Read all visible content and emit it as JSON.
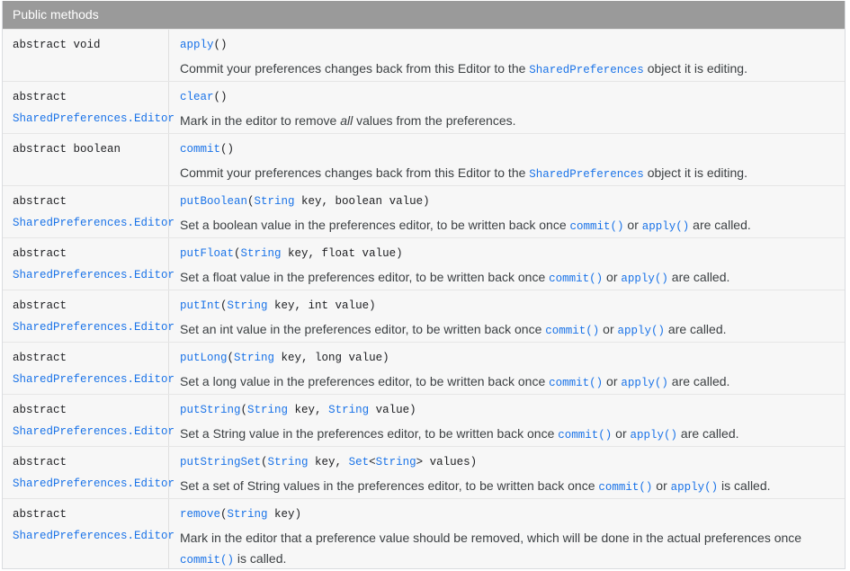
{
  "header": {
    "title": "Public methods"
  },
  "rows": [
    {
      "mod": "abstract void",
      "ret": "",
      "name": "apply",
      "params": "()",
      "d1": "Commit your preferences changes back from this Editor to the ",
      "dc1": "SharedPreferences",
      "d2": " object it is editing."
    },
    {
      "mod": "abstract",
      "ret": "SharedPreferences.Editor",
      "name": "clear",
      "params": "()",
      "d1": "Mark in the editor to remove ",
      "em": "all",
      "d2": " values from the preferences."
    },
    {
      "mod": "abstract boolean",
      "ret": "",
      "name": "commit",
      "params": "()",
      "d1": "Commit your preferences changes back from this Editor to the ",
      "dc1": "SharedPreferences",
      "d2": " object it is editing."
    },
    {
      "mod": "abstract",
      "ret": "SharedPreferences.Editor",
      "name": "putBoolean",
      "p_open": "(",
      "t1": "String",
      "n1": " key, boolean value",
      "p_close": ")",
      "d1": "Set a boolean value in the preferences editor, to be written back once ",
      "dc1": "commit()",
      "d2": " or ",
      "dc2": "apply()",
      "d3": " are called."
    },
    {
      "mod": "abstract",
      "ret": "SharedPreferences.Editor",
      "name": "putFloat",
      "p_open": "(",
      "t1": "String",
      "n1": " key, float value",
      "p_close": ")",
      "d1": "Set a float value in the preferences editor, to be written back once ",
      "dc1": "commit()",
      "d2": " or ",
      "dc2": "apply()",
      "d3": " are called."
    },
    {
      "mod": "abstract",
      "ret": "SharedPreferences.Editor",
      "name": "putInt",
      "p_open": "(",
      "t1": "String",
      "n1": " key, int value",
      "p_close": ")",
      "d1": "Set an int value in the preferences editor, to be written back once ",
      "dc1": "commit()",
      "d2": " or ",
      "dc2": "apply()",
      "d3": " are called."
    },
    {
      "mod": "abstract",
      "ret": "SharedPreferences.Editor",
      "name": "putLong",
      "p_open": "(",
      "t1": "String",
      "n1": " key, long value",
      "p_close": ")",
      "d1": "Set a long value in the preferences editor, to be written back once ",
      "dc1": "commit()",
      "d2": " or ",
      "dc2": "apply()",
      "d3": " are called."
    },
    {
      "mod": "abstract",
      "ret": "SharedPreferences.Editor",
      "name": "putString",
      "p_open": "(",
      "t1": "String",
      "n1": " key, ",
      "t2": "String",
      "n2": " value",
      "p_close": ")",
      "d1": "Set a String value in the preferences editor, to be written back once ",
      "dc1": "commit()",
      "d2": " or ",
      "dc2": "apply()",
      "d3": " are called."
    },
    {
      "mod": "abstract",
      "ret": "SharedPreferences.Editor",
      "name": "putStringSet",
      "p_open": "(",
      "t1": "String",
      "n1": " key, ",
      "t2": "Set",
      "t2b": "<",
      "t2c": "String",
      "t2d": ">",
      "n2": " values",
      "p_close": ")",
      "d1": "Set a set of String values in the preferences editor, to be written back once ",
      "dc1": "commit()",
      "d2": " or ",
      "dc2": "apply()",
      "d3": " is called."
    },
    {
      "mod": "abstract",
      "ret": "SharedPreferences.Editor",
      "name": "remove",
      "p_open": "(",
      "t1": "String",
      "n1": " key",
      "p_close": ")",
      "d1": "Mark in the editor that a preference value should be removed, which will be done in the actual preferences once",
      "dc1": "commit()",
      "d2": " is called."
    }
  ]
}
